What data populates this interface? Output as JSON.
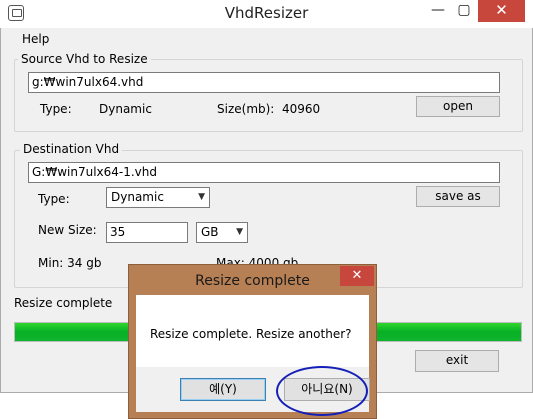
{
  "window": {
    "title": "VhdResizer",
    "minimize": "—",
    "maximize": "▢",
    "close": "✕"
  },
  "menu": {
    "help": "Help"
  },
  "source": {
    "group_label": "Source Vhd to Resize",
    "path": "g:₩win7ulx64.vhd",
    "type_label": "Type:",
    "type_value": "Dynamic",
    "size_label": "Size(mb):",
    "size_value": "40960",
    "open_button": "open"
  },
  "destination": {
    "group_label": "Destination Vhd",
    "path": "G:₩win7ulx64-1.vhd",
    "type_label": "Type:",
    "type_value": "Dynamic",
    "save_as_button": "save as",
    "new_size_label": "New Size:",
    "new_size_value": "35",
    "unit_value": "GB",
    "min_text": "Min: 34 gb",
    "max_text": "Max: 4000 gb"
  },
  "status": {
    "text": "Resize complete",
    "progress_fraction": 1.0
  },
  "exit_button": "exit",
  "dialog": {
    "title": "Resize complete",
    "close": "✕",
    "message": "Resize complete. Resize another?",
    "yes_button": "예(Y)",
    "no_button": "아니요(N)"
  },
  "colors": {
    "progress": "#06b025",
    "dialog_frame": "#b67f54",
    "close_red": "#c7473d",
    "highlight": "#1520b8"
  }
}
